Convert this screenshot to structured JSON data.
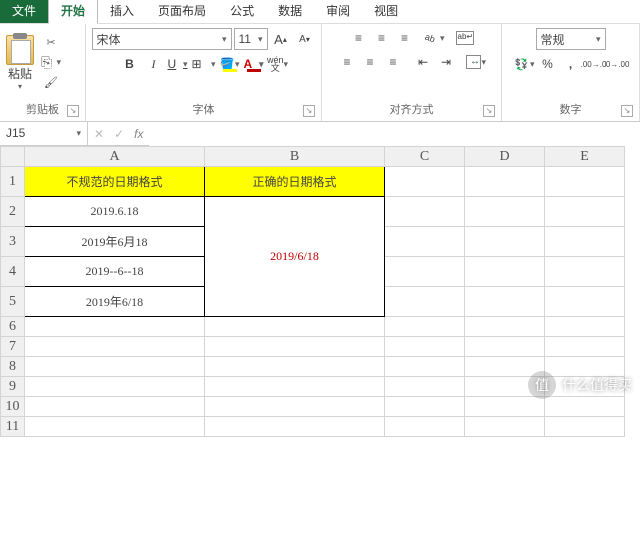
{
  "tabs": {
    "file": "文件",
    "home": "开始",
    "insert": "插入",
    "layout": "页面布局",
    "formulas": "公式",
    "data": "数据",
    "review": "审阅",
    "view": "视图"
  },
  "ribbon": {
    "clipboard": {
      "label": "剪贴板",
      "paste": "粘贴"
    },
    "font": {
      "label": "字体",
      "name": "宋体",
      "size": "11",
      "bold": "B",
      "italic": "I",
      "underline": "U",
      "glyph": "A"
    },
    "alignment": {
      "label": "对齐方式"
    },
    "number": {
      "label": "数字",
      "format": "常规"
    }
  },
  "formulaBar": {
    "name": "J15",
    "cancel": "✕",
    "confirm": "✓",
    "fx": "fx",
    "value": ""
  },
  "columns": [
    "A",
    "B",
    "C",
    "D",
    "E"
  ],
  "rows": [
    "1",
    "2",
    "3",
    "4",
    "5",
    "6",
    "7",
    "8",
    "9",
    "10",
    "11"
  ],
  "cells": {
    "header_a": "不规范的日期格式",
    "header_b": "正确的日期格式",
    "a2": "2019.6.18",
    "a3": "2019年6月18",
    "a4": "2019--6--18",
    "a5": "2019年6/18",
    "b_merged": "2019/6/18"
  },
  "watermark": {
    "badge": "值",
    "text": "什么值得买"
  }
}
